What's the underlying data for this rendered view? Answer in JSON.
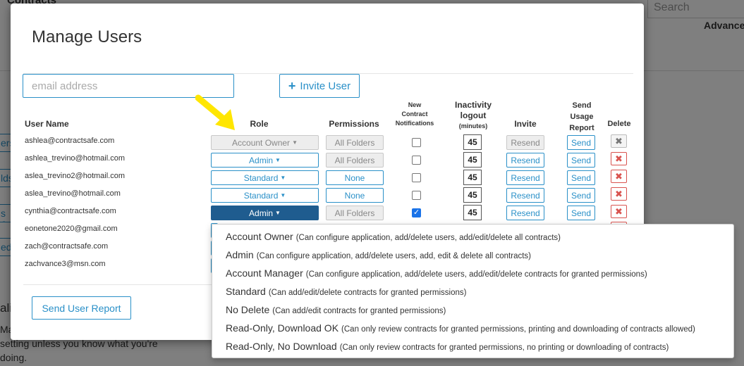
{
  "background": {
    "page_title": "Contracts",
    "search_placeholder": "Search",
    "advanced_label": "Advanced",
    "sidebar_fragments": [
      "ers",
      "lds",
      "s &",
      "ed"
    ],
    "section_fragment": "ali",
    "help_text_fragment": "Ma\nsetting unless you know what you're\ndoing."
  },
  "modal": {
    "title": "Manage Users",
    "email_placeholder": "email address",
    "invite_button": "Invite User",
    "send_report_button": "Send User Report"
  },
  "columns": {
    "user_name": "User Name",
    "role": "Role",
    "permissions": "Permissions",
    "notifications_1": "New",
    "notifications_2": "Contract",
    "notifications_3": "Notifications",
    "inactivity_1": "Inactivity",
    "inactivity_2": "logout",
    "inactivity_3": "(minutes)",
    "invite": "Invite",
    "usage_1": "Send",
    "usage_2": "Usage",
    "usage_3": "Report",
    "delete": "Delete"
  },
  "users": [
    {
      "email": "ashlea@contractsafe.com",
      "role": "Account Owner",
      "permissions": "All Folders",
      "notify": false,
      "logout": "45",
      "invite": "Resend",
      "usage": "Send"
    },
    {
      "email": "ashlea_trevino@hotmail.com",
      "role": "Admin",
      "permissions": "All Folders",
      "notify": false,
      "logout": "45",
      "invite": "Resend",
      "usage": "Send"
    },
    {
      "email": "aslea_trevino2@hotmail.com",
      "role": "Standard",
      "permissions": "None",
      "notify": false,
      "logout": "45",
      "invite": "Resend",
      "usage": "Send"
    },
    {
      "email": "aslea_trevino@hotmail.com",
      "role": "Standard",
      "permissions": "None",
      "notify": false,
      "logout": "45",
      "invite": "Resend",
      "usage": "Send"
    },
    {
      "email": "cynthia@contractsafe.com",
      "role": "Admin",
      "permissions": "All Folders",
      "notify": true,
      "logout": "45",
      "invite": "Resend",
      "usage": "Send"
    },
    {
      "email": "eonetone2020@gmail.com"
    },
    {
      "email": "zach@contractsafe.com"
    },
    {
      "email": "zachvance3@msn.com"
    }
  ],
  "role_options": [
    {
      "name": "Account Owner",
      "desc": "(Can configure application, add/delete users, add/edit/delete all contracts)"
    },
    {
      "name": "Admin",
      "desc": "(Can configure application, add/delete users, add, edit & delete all contracts)"
    },
    {
      "name": "Account Manager",
      "desc": "(Can configure application, add/delete users, add/edit/delete contracts for granted permissions)"
    },
    {
      "name": "Standard",
      "desc": "(Can add/edit/delete contracts for granted permissions)"
    },
    {
      "name": "No Delete",
      "desc": "(Can add/edit contracts for granted permissions)"
    },
    {
      "name": "Read-Only, Download OK",
      "desc": "(Can only review contracts for granted permissions, printing and downloading of contracts allowed)"
    },
    {
      "name": "Read-Only, No Download",
      "desc": "(Can only review contracts for granted permissions, no printing or downloading of contracts)"
    }
  ],
  "colors": {
    "accent": "#2a90c8",
    "active_role": "#1f5c8f",
    "delete": "#d9534f",
    "arrow": "#ffe600"
  }
}
